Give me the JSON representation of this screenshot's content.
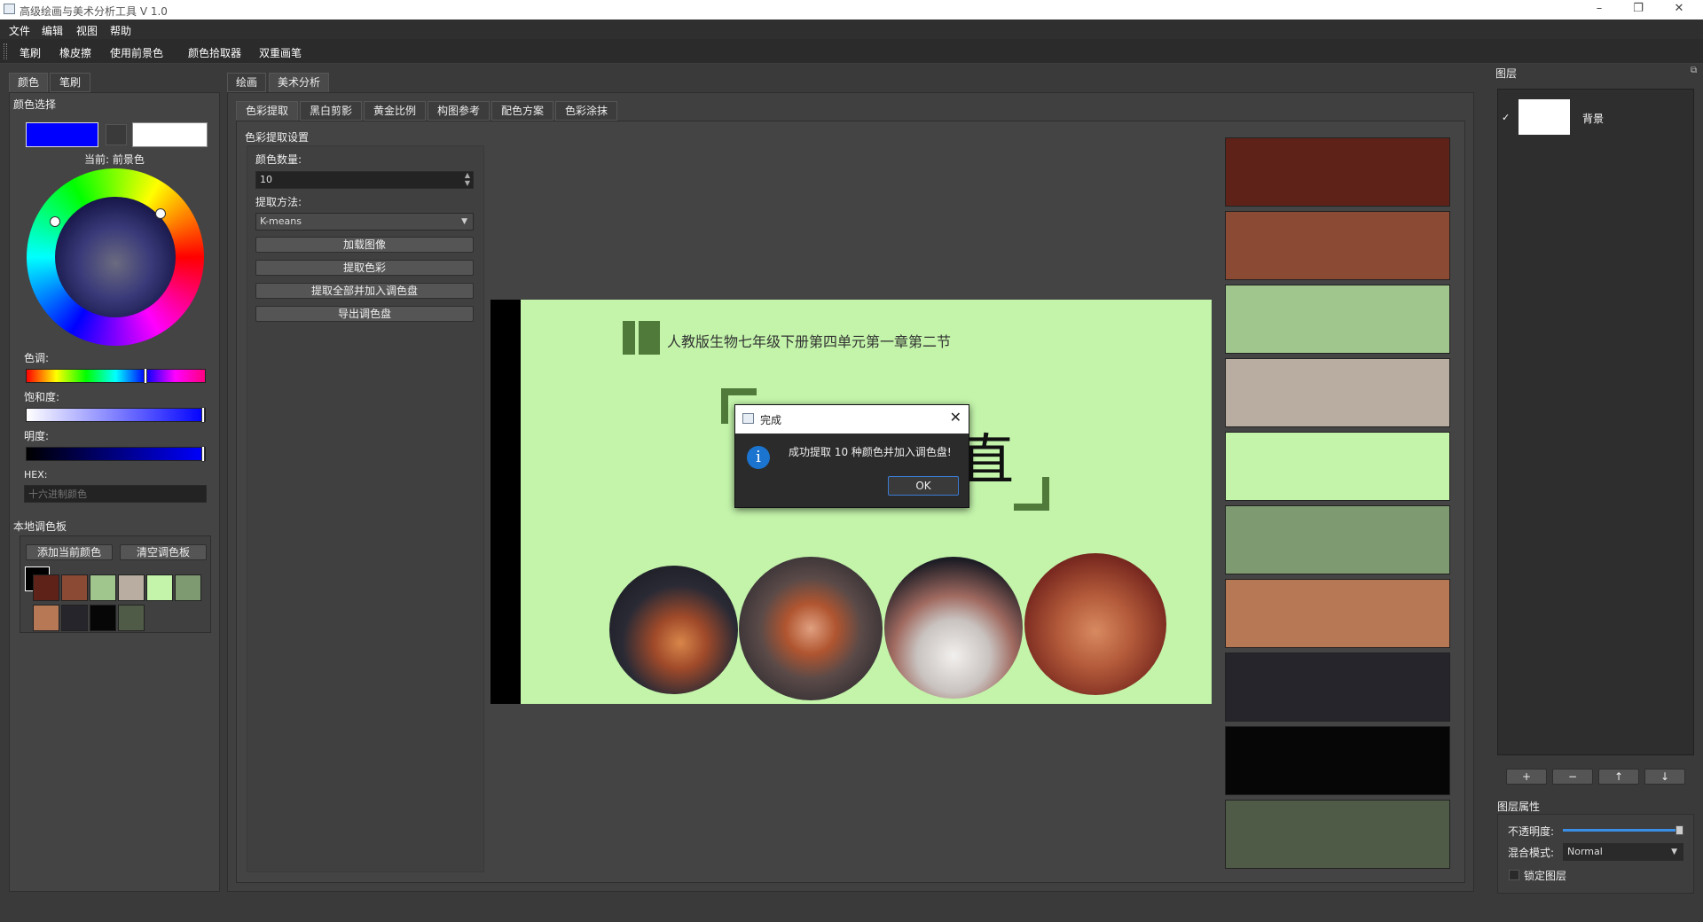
{
  "window": {
    "title": "高级绘画与美术分析工具 V 1.0",
    "minimize": "–",
    "restore": "❐",
    "close": "✕"
  },
  "menu": [
    "文件",
    "编辑",
    "视图",
    "帮助"
  ],
  "toolbar": [
    "笔刷",
    "橡皮擦",
    "使用前景色",
    "颜色拾取器",
    "双重画笔"
  ],
  "left_panel": {
    "tabs": [
      "颜色",
      "笔刷"
    ],
    "section_title": "颜色选择",
    "foreground_color": "#0000ff",
    "background_color": "#ffffff",
    "current_label": "当前: 前景色",
    "hue_label": "色调:",
    "saturation_label": "饱和度:",
    "brightness_label": "明度:",
    "hex_label": "HEX:",
    "hex_placeholder": "十六进制颜色",
    "hue_value": 0.67,
    "local_palette_title": "本地调色板",
    "add_color_button": "添加当前颜色",
    "clear_palette_button": "清空调色板",
    "palette_colors": [
      "#5f2218",
      "#8b4a33",
      "#a0c68e",
      "#b8ada0",
      "#c3f4aa",
      "#7d9a70",
      "#b77855",
      "#25252b",
      "#060606",
      "#4f5b47"
    ]
  },
  "center": {
    "main_tabs": [
      "绘画",
      "美术分析"
    ],
    "sub_tabs": [
      "色彩提取",
      "黑白剪影",
      "黄金比例",
      "构图参考",
      "配色方案",
      "色彩涂抹"
    ],
    "settings_title": "色彩提取设置",
    "color_count_label": "颜色数量:",
    "color_count_value": "10",
    "method_label": "提取方法:",
    "method_value": "K-means",
    "load_image_button": "加载图像",
    "extract_button": "提取色彩",
    "extract_all_button": "提取全部并加入调色盘",
    "export_button": "导出调色盘",
    "image_subtitle": "人教版生物七年级下册第四单元第一章第二节",
    "image_title_char": "直"
  },
  "extracted_colors": [
    "#5f2218",
    "#8b4a33",
    "#a0c68e",
    "#b8ada0",
    "#c3f4aa",
    "#7d9a70",
    "#b77855",
    "#25252b",
    "#060606",
    "#4f5b47"
  ],
  "dialog": {
    "title": "完成",
    "message": "成功提取 10 种颜色并加入调色盘!",
    "ok_button": "OK"
  },
  "layers": {
    "title": "图层",
    "layer_name": "背景",
    "add_button": "+",
    "remove_button": "−",
    "up_button": "↑",
    "down_button": "↓",
    "properties_title": "图层属性",
    "opacity_label": "不透明度:",
    "opacity_value": 1.0,
    "blend_label": "混合模式:",
    "blend_value": "Normal",
    "lock_label": "锁定图层"
  }
}
